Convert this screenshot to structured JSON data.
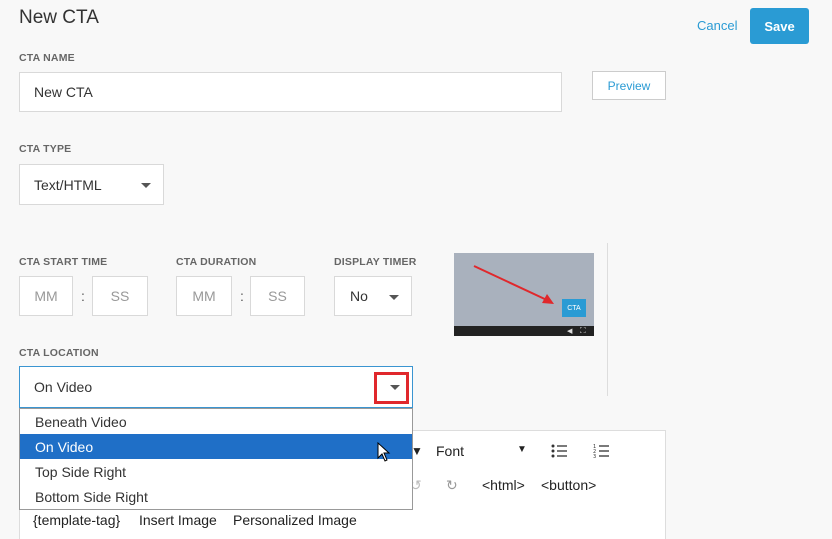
{
  "header": {
    "title": "New CTA",
    "cancel_label": "Cancel",
    "save_label": "Save"
  },
  "cta_name": {
    "label": "CTA NAME",
    "value": "New CTA",
    "preview_label": "Preview"
  },
  "cta_type": {
    "label": "CTA TYPE",
    "value": "Text/HTML"
  },
  "start_time": {
    "label": "CTA START TIME",
    "mm": "MM",
    "ss": "SS",
    "sep": ":"
  },
  "duration": {
    "label": "CTA DURATION",
    "mm": "MM",
    "ss": "SS",
    "sep": ":"
  },
  "display_timer": {
    "label": "DISPLAY TIMER",
    "value": "No"
  },
  "thumbnail": {
    "badge": "CTA"
  },
  "location": {
    "label": "CTA LOCATION",
    "value": "On Video",
    "options": [
      "Beneath Video",
      "On Video",
      "Top Side Right",
      "Bottom Side Right"
    ],
    "selected_index": 1
  },
  "editor": {
    "font_label": "Font",
    "html_label": "<html>",
    "button_label": "<button>",
    "template_tag": "{template-tag}",
    "insert_image": "Insert Image",
    "personalized_image": "Personalized Image"
  },
  "colors": {
    "accent": "#2a9bd4",
    "selected": "#1f6fc7",
    "highlight": "#e0282c"
  }
}
